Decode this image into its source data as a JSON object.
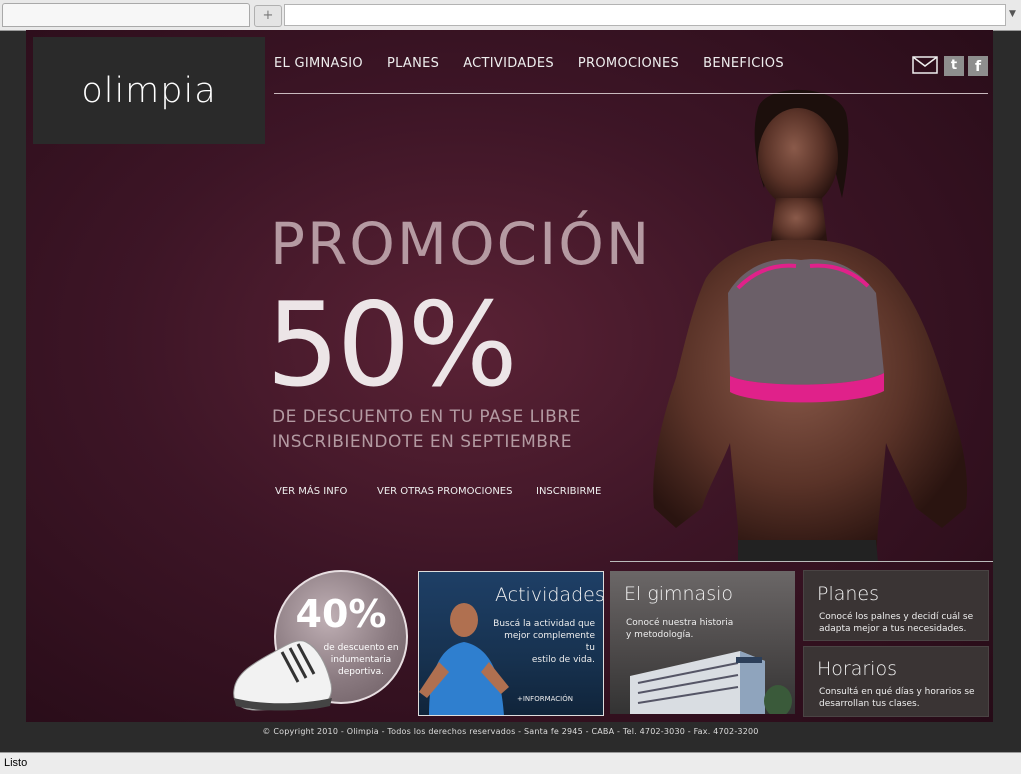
{
  "browser": {
    "new_tab_icon": "plus-icon",
    "dropdown_icon": "chevron-down-icon",
    "status": "Listo"
  },
  "brand": {
    "logo": "olimpia"
  },
  "nav": {
    "items": [
      "EL GIMNASIO",
      "PLANES",
      "ACTIVIDADES",
      "PROMOCIONES",
      "BENEFICIOS"
    ],
    "social": [
      "mail-icon",
      "twitter-icon",
      "facebook-icon"
    ],
    "twitter_glyph": "t",
    "facebook_glyph": "f"
  },
  "hero": {
    "title": "PROMOCIÓN",
    "percent": "50%",
    "line1": "DE DESCUENTO EN TU PASE LIBRE",
    "line2": "INSCRIBIENDOTE EN SEPTIEMBRE",
    "links": [
      "VER MÁS INFO",
      "VER OTRAS PROMOCIONES",
      "INSCRIBIRME"
    ]
  },
  "badge": {
    "percent": "40%",
    "line1": "de descuento en",
    "line2": "indumentaria",
    "line3": "deportiva."
  },
  "cards": {
    "actividades": {
      "title": "Actividades",
      "line1": "Buscá la actividad que",
      "line2": "mejor complemente tu",
      "line3": "estilo de vida.",
      "more": "+INFORMACIÓN"
    },
    "gimnasio": {
      "title": "El gimnasio",
      "line1": "Conocé nuestra historia",
      "line2": "y metodología."
    },
    "planes": {
      "title": "Planes",
      "line1": "Conocé los palnes y decidí cuál se",
      "line2": "adapta mejor a tus necesidades."
    },
    "horarios": {
      "title": "Horarios",
      "line1": "Consultá en qué días y horarios se",
      "line2": "desarrollan tus clases."
    }
  },
  "footer": "© Copyright 2010 - Olimpia - Todos los derechos reservados - Santa fe 2945 - CABA - Tel. 4702-3030 - Fax. 4702-3200",
  "colors": {
    "page_bg": "#3d1526",
    "accent_pink": "#e0218a",
    "card_dark": "#3a3434"
  }
}
